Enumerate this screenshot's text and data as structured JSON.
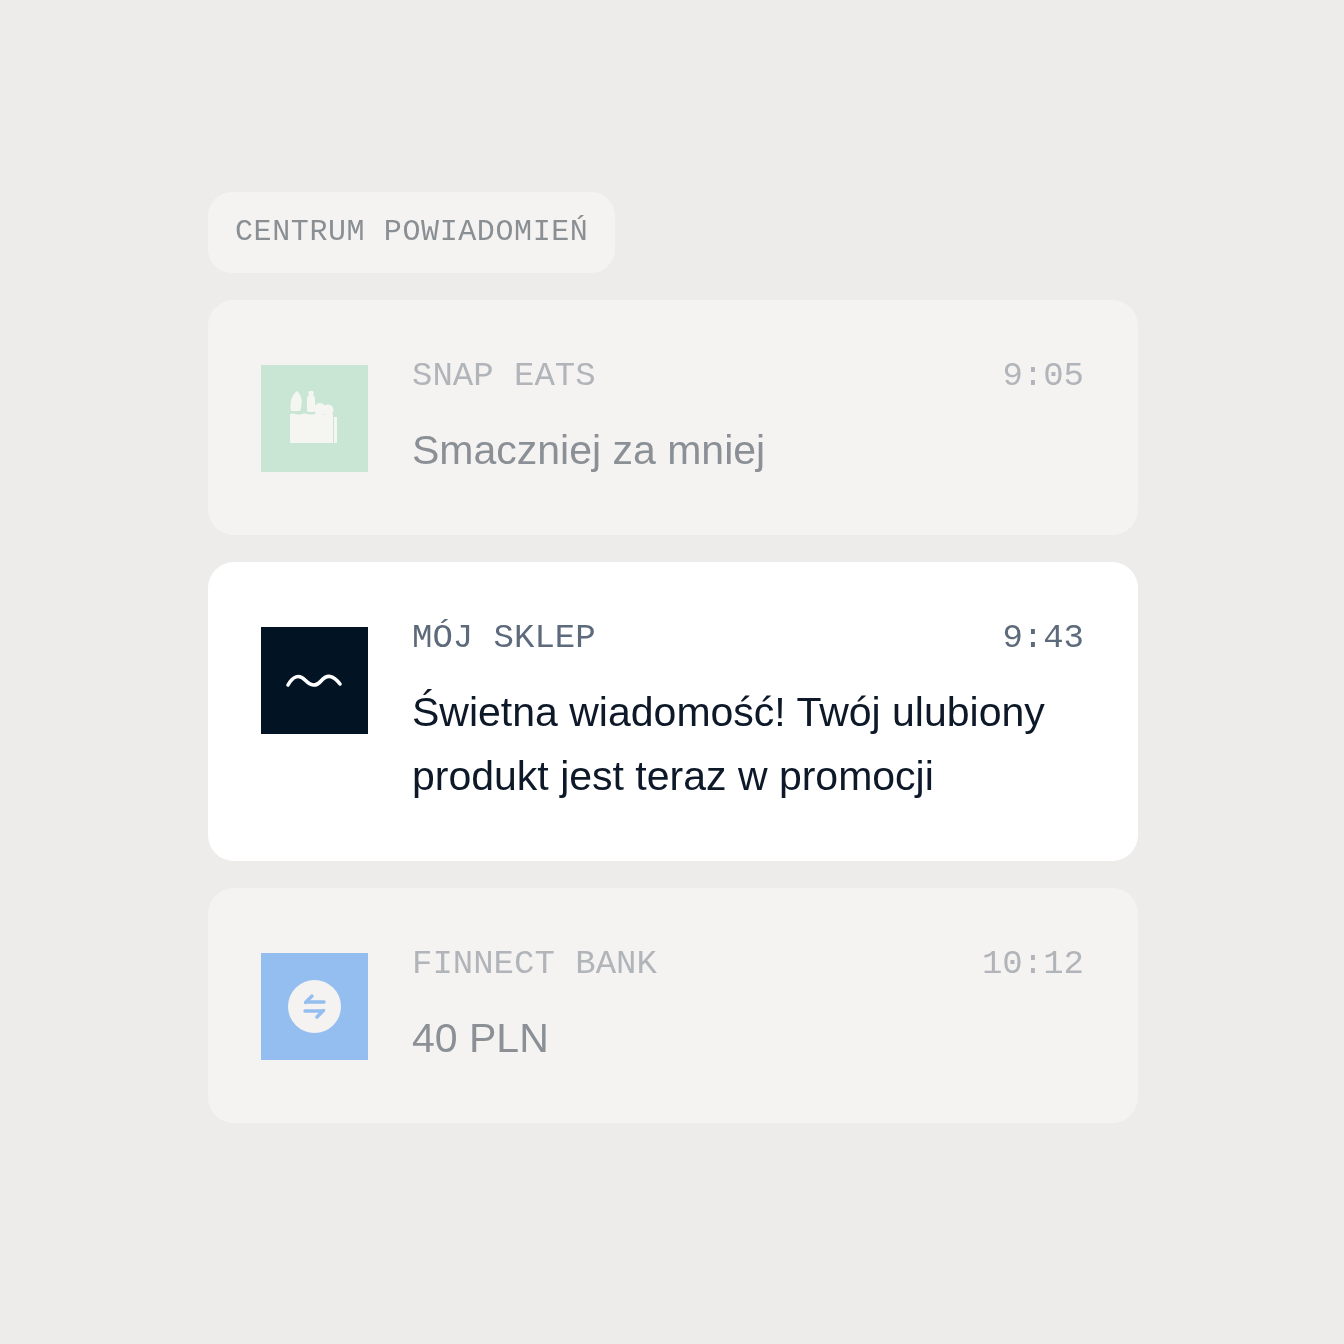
{
  "header": {
    "title": "CENTRUM POWIADOMIEŃ"
  },
  "notifications": [
    {
      "kind": "grocery",
      "color": "#c8e6d3",
      "app": "SNAP EATS",
      "time": "9:05",
      "message": "Smaczniej za mniej",
      "active": false
    },
    {
      "kind": "wave",
      "color": "#021424",
      "app": "MÓJ SKLEP",
      "time": "9:43",
      "message": "Świetna wiadomość! Twój ulubiony produkt jest teraz w promocji",
      "active": true
    },
    {
      "kind": "transfer",
      "color": "#94bdf0",
      "app": "FINNECT BANK",
      "time": "10:12",
      "message": "40 PLN",
      "active": false
    }
  ]
}
